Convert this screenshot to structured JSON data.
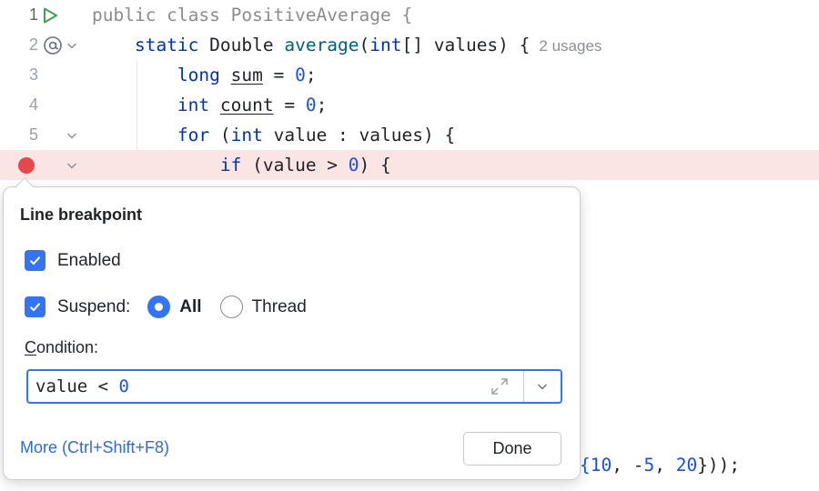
{
  "editor": {
    "lines": [
      {
        "number": "1"
      },
      {
        "number": "2",
        "hint": "2 usages"
      },
      {
        "number": "3"
      },
      {
        "number": "4"
      },
      {
        "number": "5"
      },
      {
        "number": ""
      }
    ],
    "bottom_line_fragment": "{10, -5, 20}));",
    "colors": {
      "breakpoint_line": "#fae4e4",
      "breakpoint_dot": "#e5484d",
      "run_icon": "#3fa34d"
    }
  },
  "popup": {
    "title": "Line breakpoint",
    "enabled_label": "Enabled",
    "enabled_checked": true,
    "suspend_label": "Suspend:",
    "suspend_checked": true,
    "suspend_options": [
      "All",
      "Thread"
    ],
    "suspend_selected": "All",
    "condition_label_accel": "C",
    "condition_label_rest": "ondition:",
    "condition_value": "value < 0",
    "more_link": "More (Ctrl+Shift+F8)",
    "done_button": "Done",
    "accent": "#3574f0"
  }
}
